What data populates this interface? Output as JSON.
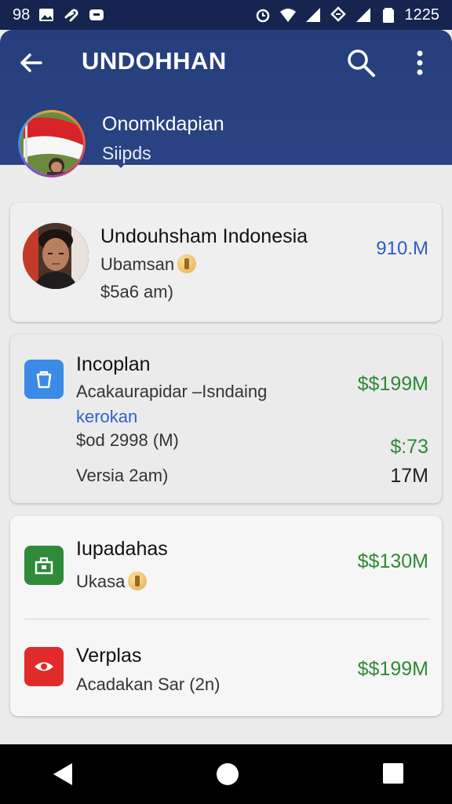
{
  "status_bar": {
    "left_text": "98",
    "time": "1225",
    "left_icons": [
      "image-icon",
      "link-icon",
      "message-icon"
    ],
    "right_icons": [
      "alarm-icon",
      "wifi-icon",
      "signal-icon",
      "data-icon",
      "signal-icon-2",
      "battery-icon"
    ]
  },
  "app_bar": {
    "title": "UNDOHHAN",
    "back_icon": "arrow-left-icon",
    "search_icon": "search-icon",
    "more_icon": "more-vert-icon",
    "background": "#2a4382"
  },
  "profile": {
    "name": "Onomkdapian",
    "subtitle": "Siipds"
  },
  "cards": [
    {
      "name": "Undouhsham Indonesia",
      "subtitle": "Ubamsan",
      "meta": "$5a6 am)",
      "amount": "910.M",
      "amount_color": "#2b5ec3"
    },
    {
      "name": "Incoplan",
      "subtitle": "Acakaurapidar –Isndaing",
      "link": "kerokan",
      "meta": "$od 2998 (M)",
      "version": "Versia 2am)",
      "amount": "$$199M",
      "amount2": "$:73",
      "amount3": "17M",
      "icon_color": "#3b8ae6"
    }
  ],
  "list_card": [
    {
      "name": "Iupadahas",
      "subtitle": "Ukasa",
      "amount": "$$130M",
      "icon_color": "#2f8a3a"
    },
    {
      "name": "Verplas",
      "subtitle": "Acadakan Sar (2n)",
      "amount": "$$199M",
      "icon_color": "#e12b2b"
    }
  ],
  "colors": {
    "accent_green": "#2e8a35",
    "accent_blue": "#2b5ec3",
    "header_blue": "#263e7c"
  }
}
